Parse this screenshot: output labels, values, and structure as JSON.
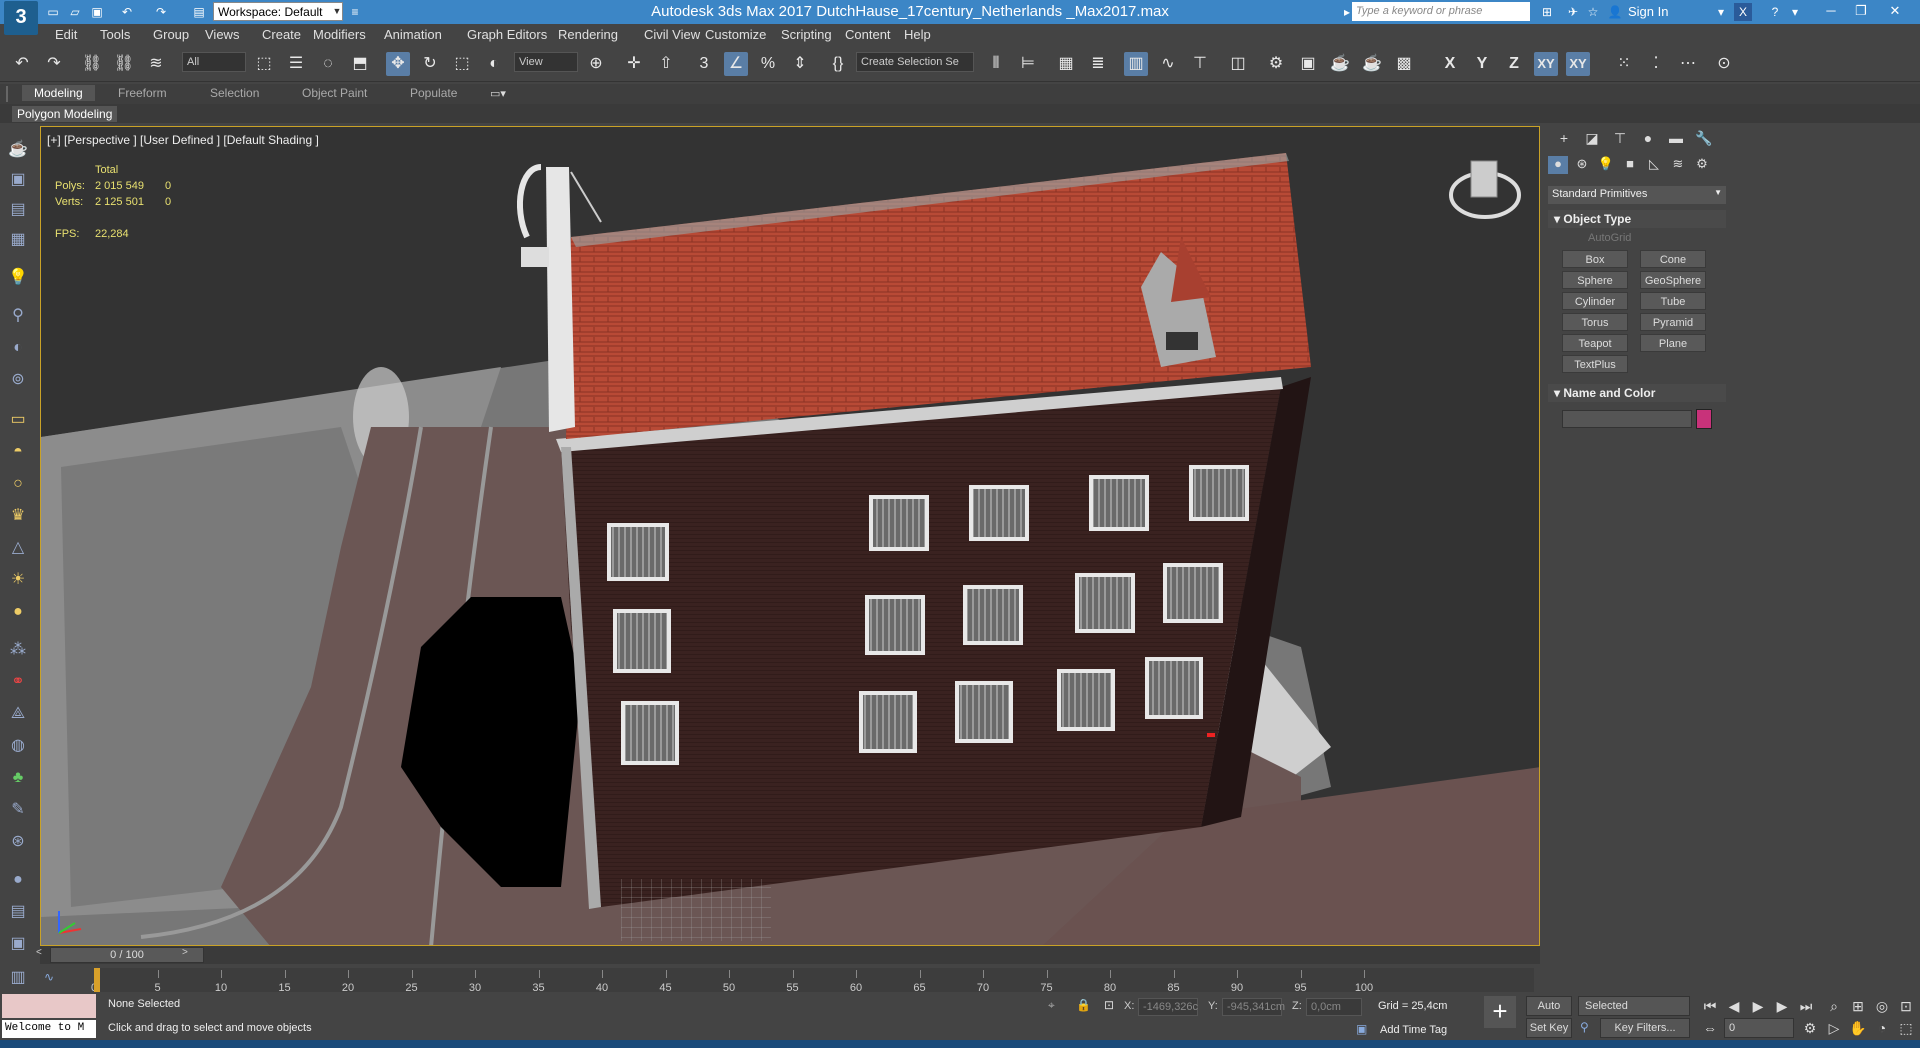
{
  "titlebar": {
    "logo": "3",
    "workspace": "Workspace: Default",
    "title": "Autodesk 3ds Max 2017      DutchHause_17century_Netherlands _Max2017.max",
    "search_placeholder": "Type a keyword or phrase",
    "signin": "Sign In"
  },
  "menus": [
    "Edit",
    "Tools",
    "Group",
    "Views",
    "Create",
    "Modifiers",
    "Animation",
    "Graph Editors",
    "Rendering",
    "Civil View",
    "Customize",
    "Scripting",
    "Content",
    "Help"
  ],
  "toolbar": {
    "filter": "All",
    "refcoord": "View",
    "selection_set": "Create Selection Se",
    "axes": [
      "X",
      "Y",
      "Z",
      "XY",
      "XY"
    ]
  },
  "ribbon": {
    "tabs": [
      "Modeling",
      "Freeform",
      "Selection",
      "Object Paint",
      "Populate"
    ],
    "panel": "Polygon Modeling"
  },
  "viewport": {
    "label": "[+] [Perspective ] [User Defined ] [Default Shading ]",
    "stats": {
      "total_label": "Total",
      "polys_label": "Polys:",
      "polys": "2 015 549",
      "polys_sel": "0",
      "verts_label": "Verts:",
      "verts": "2 125 501",
      "verts_sel": "0",
      "fps_label": "FPS:",
      "fps": "22,284"
    }
  },
  "command_panel": {
    "category": "Standard Primitives",
    "object_type_title": "Object Type",
    "autogrid": "AutoGrid",
    "buttons": [
      "Box",
      "Cone",
      "Sphere",
      "GeoSphere",
      "Cylinder",
      "Tube",
      "Torus",
      "Pyramid",
      "Teapot",
      "Plane",
      "TextPlus"
    ],
    "name_color_title": "Name and Color",
    "object_color": "#c8327a"
  },
  "timeline": {
    "slider_label": "0 / 100",
    "ticks": [
      "0",
      "5",
      "10",
      "15",
      "20",
      "25",
      "30",
      "35",
      "40",
      "45",
      "50",
      "55",
      "60",
      "65",
      "70",
      "75",
      "80",
      "85",
      "90",
      "95",
      "100"
    ]
  },
  "statusbar": {
    "maxscript": "Welcome to M",
    "selection": "None Selected",
    "prompt": "Click and drag to select and move objects",
    "x_label": "X:",
    "x": "-1469,326c",
    "y_label": "Y:",
    "y": "-945,341cm",
    "z_label": "Z:",
    "z": "0,0cm",
    "grid": "Grid = 25,4cm",
    "add_time_tag": "Add Time Tag",
    "auto_key": "Auto Key",
    "selected": "Selected",
    "set_key": "Set Key",
    "key_filters": "Key Filters...",
    "frame": "0"
  }
}
